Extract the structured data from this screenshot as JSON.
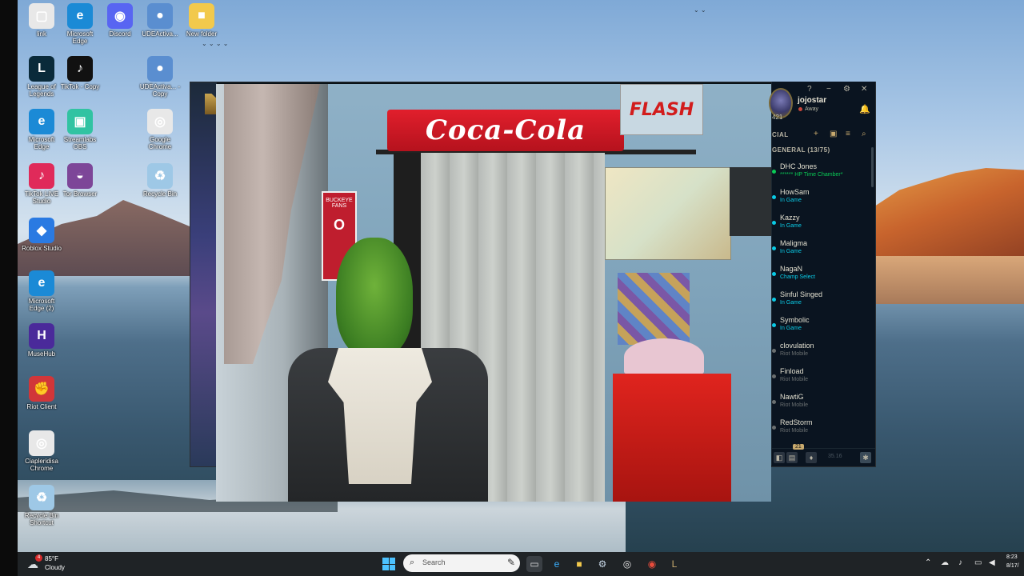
{
  "desktop_icons": [
    {
      "label": "link",
      "color": "#e8e8e8",
      "glyph": "▢"
    },
    {
      "label": "Microsoft Edge",
      "color": "#1b8ad6",
      "glyph": "e"
    },
    {
      "label": "Discord",
      "color": "#5865f2",
      "glyph": "◉"
    },
    {
      "label": "UDEActiva...",
      "color": "#5a8ed0",
      "glyph": "●"
    },
    {
      "label": "New folder",
      "color": "#f2c94c",
      "glyph": "■"
    },
    {
      "label": "League of Legends",
      "color": "#0a2a3a",
      "glyph": "L"
    },
    {
      "label": "TikTok - Copy",
      "color": "#111111",
      "glyph": "♪"
    },
    {
      "label": "UDEActiva... - Copy",
      "color": "#5a8ed0",
      "glyph": "●"
    },
    {
      "label": "Microsoft Edge",
      "color": "#1b8ad6",
      "glyph": "e"
    },
    {
      "label": "Streamlabs OBS",
      "color": "#31c3a2",
      "glyph": "▣"
    },
    {
      "label": "Google Chrome",
      "color": "#e8e8e8",
      "glyph": "◎"
    },
    {
      "label": "TikTok LIVE Studio",
      "color": "#e02a5a",
      "glyph": "♪"
    },
    {
      "label": "Tor Browser",
      "color": "#7d4698",
      "glyph": "◒"
    },
    {
      "label": "Recycle Bin",
      "color": "#9ec8e6",
      "glyph": "♻"
    },
    {
      "label": "Roblox Studio",
      "color": "#2a7ae2",
      "glyph": "◆"
    },
    {
      "label": "Microsoft Edge (2)",
      "color": "#1b8ad6",
      "glyph": "e"
    },
    {
      "label": "MuseHub",
      "color": "#4a2a9a",
      "glyph": "H"
    },
    {
      "label": "Riot Client",
      "color": "#d13639",
      "glyph": "✊"
    },
    {
      "label": "Ciapleridisa Chrome",
      "color": "#e8e8e8",
      "glyph": "◎"
    },
    {
      "label": "Recycle Bin Shortcut",
      "color": "#9ec8e6",
      "glyph": "♻"
    }
  ],
  "webcam": {
    "sign_text": "Coca-Cola",
    "flash_text": "FLASH",
    "ohio_top": "BUCKEYE FANS",
    "ohio_letters": "O"
  },
  "friends_panel": {
    "controls": {
      "help": "?",
      "minimize": "−",
      "settings": "⚙",
      "close": "✕"
    },
    "profile": {
      "name": "jojostar",
      "status": "Away",
      "level": "421"
    },
    "social_label": "CIAL",
    "group_label": "GENERAL (13/75)",
    "friends": [
      {
        "name": "DHC Jones",
        "status": "****** HP Time Chamber*",
        "state": "custom"
      },
      {
        "name": "HowSam",
        "status": "In Game",
        "state": "ingame"
      },
      {
        "name": "Kazzy",
        "status": "In Game",
        "state": "ingame"
      },
      {
        "name": "Maligma",
        "status": "In Game",
        "state": "ingame"
      },
      {
        "name": "NagaN",
        "status": "Champ Select",
        "state": "champ"
      },
      {
        "name": "Sinful Singed",
        "status": "In Game",
        "state": "ingame"
      },
      {
        "name": "Symbolic",
        "status": "In Game",
        "state": "ingame"
      },
      {
        "name": "clovulation",
        "status": "Riot Mobile",
        "state": "mobile"
      },
      {
        "name": "Finload",
        "status": "Riot Mobile",
        "state": "mobile"
      },
      {
        "name": "NawtiG",
        "status": "Riot Mobile",
        "state": "mobile"
      },
      {
        "name": "RedStorm",
        "status": "Riot Mobile",
        "state": "mobile"
      }
    ],
    "bottom": {
      "badge": "21",
      "version": "35.16"
    }
  },
  "taskbar": {
    "weather": {
      "temp": "85°F",
      "condition": "Cloudy",
      "badge": "4"
    },
    "search_placeholder": "Search",
    "clock": {
      "time": "8:23",
      "date": "8/17/"
    }
  },
  "colors": {
    "ingame": "#0acbe6",
    "mobile": "#6a6f70",
    "custom": "#0acb56",
    "gold": "#c8aa6e"
  }
}
